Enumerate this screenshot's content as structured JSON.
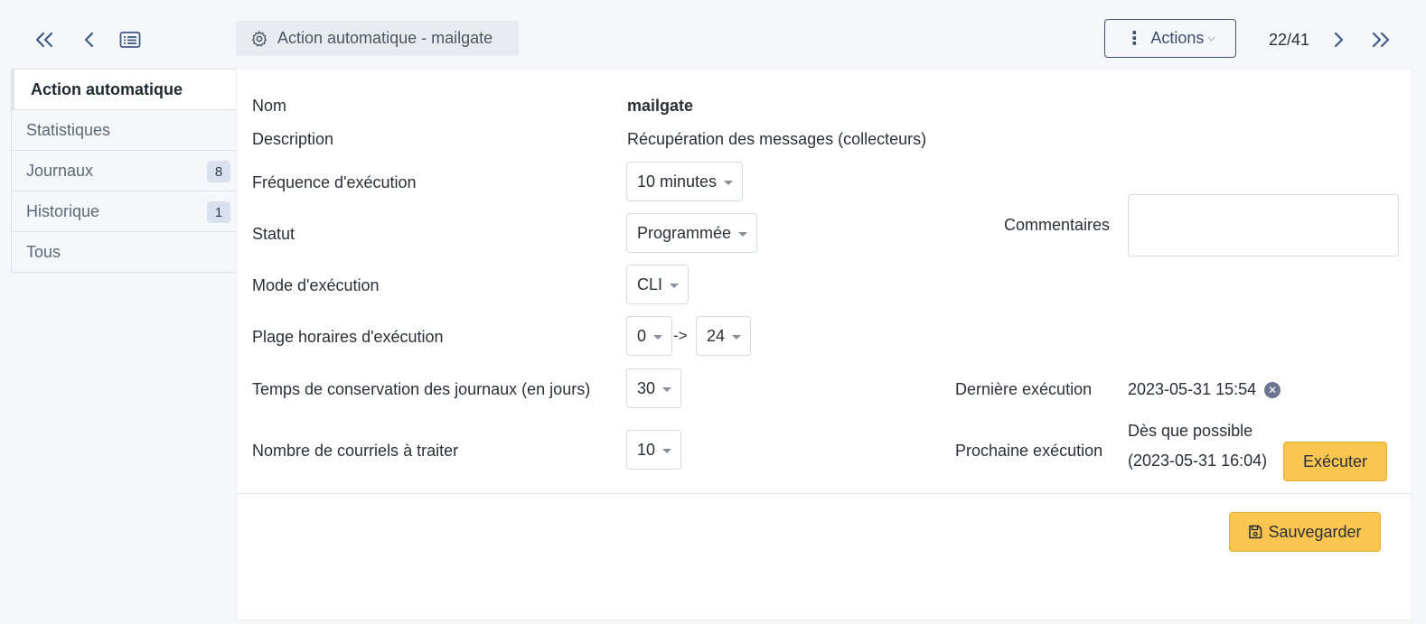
{
  "toolbar": {
    "title": "Action automatique - mailgate",
    "actions_label": "Actions",
    "pager": "22/41"
  },
  "sidebar": {
    "items": [
      {
        "label": "Action automatique",
        "badge": null
      },
      {
        "label": "Statistiques",
        "badge": null
      },
      {
        "label": "Journaux",
        "badge": "8"
      },
      {
        "label": "Historique",
        "badge": "1"
      },
      {
        "label": "Tous",
        "badge": null
      }
    ]
  },
  "form": {
    "name_label": "Nom",
    "name_value": "mailgate",
    "description_label": "Description",
    "description_value": "Récupération des messages (collecteurs)",
    "frequency_label": "Fréquence d'exécution",
    "frequency_value": "10 minutes",
    "status_label": "Statut",
    "status_value": "Programmée",
    "mode_label": "Mode d'exécution",
    "mode_value": "CLI",
    "range_label": "Plage horaires d'exécution",
    "range_start": "0",
    "range_sep": "->",
    "range_end": "24",
    "retention_label": "Temps de conservation des journaux (en jours)",
    "retention_value": "30",
    "emails_label": "Nombre de courriels à traiter",
    "emails_value": "10",
    "comments_label": "Commentaires",
    "comments_value": "",
    "last_run_label": "Dernière exécution",
    "last_run_value": "2023-05-31 15:54",
    "next_run_label": "Prochaine exécution",
    "next_run_line1": "Dès que possible",
    "next_run_line2": "(2023-05-31 16:04)",
    "execute_label": "Exécuter",
    "save_label": "Sauvegarder"
  }
}
